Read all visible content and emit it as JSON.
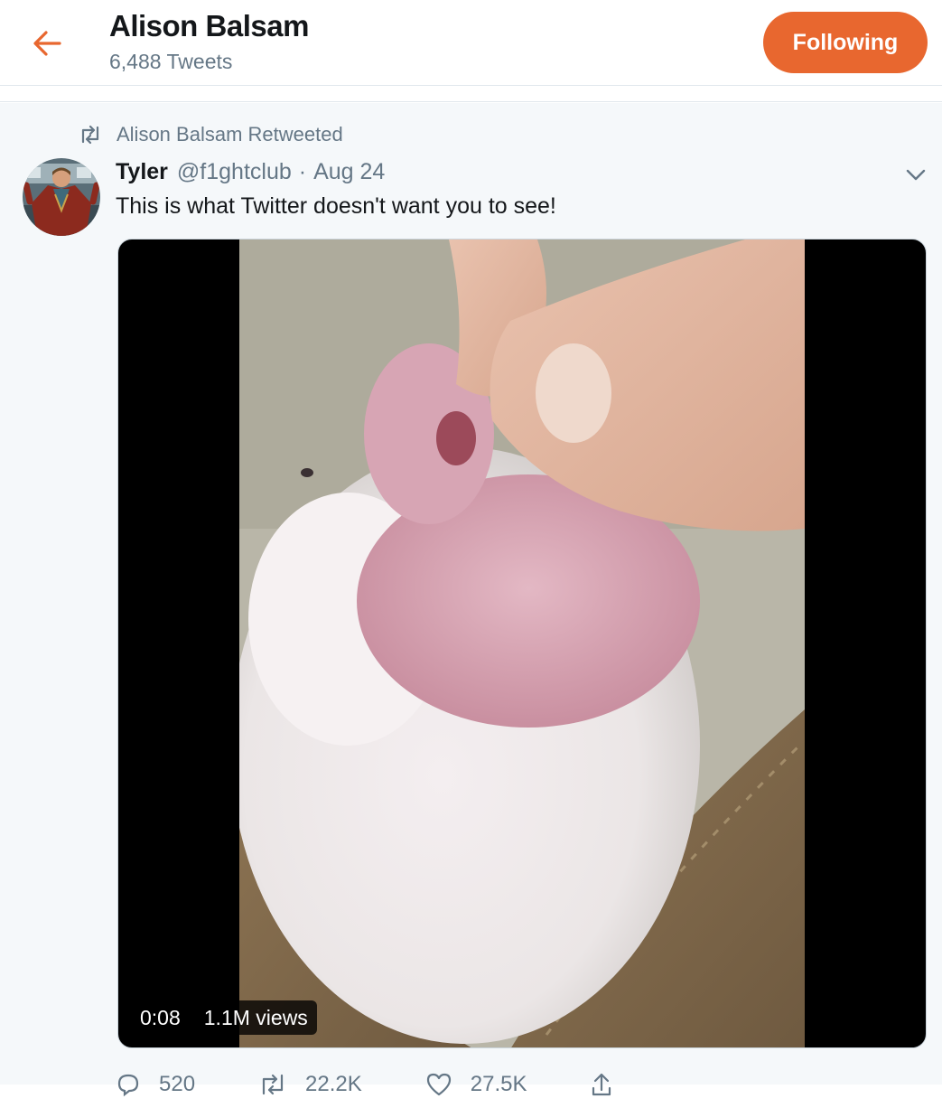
{
  "header": {
    "back_icon": "arrow-left-icon",
    "title": "Alison Balsam",
    "tweet_count": "6,488 Tweets",
    "follow_label": "Following",
    "accent_color": "#e8672f"
  },
  "tweet": {
    "retweet_context": "Alison Balsam Retweeted",
    "author_name": "Tyler",
    "author_handle": "@f1ghtclub",
    "separator": "·",
    "date": "Aug 24",
    "text": "This is what Twitter doesn't want you to see!",
    "video": {
      "duration": "0:08",
      "views": "1.1M views"
    },
    "actions": {
      "reply_count": "520",
      "retweet_count": "22.2K",
      "like_count": "27.5K"
    }
  },
  "colors": {
    "text_primary": "#14171a",
    "text_secondary": "#657786",
    "tweet_background": "#f5f8fa",
    "border": "#e1e8ed"
  }
}
